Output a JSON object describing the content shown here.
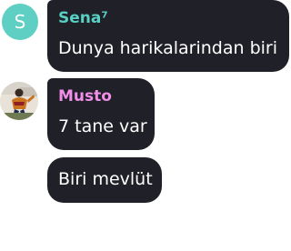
{
  "colors": {
    "bubble_bg": "#202028",
    "message_text": "#ffffff",
    "avatar_s_bg": "#5ecfc2",
    "sena_name": "#58d0c4",
    "musto_name": "#f08ee8"
  },
  "messages": [
    {
      "sender": "Sena⁷",
      "avatar_letter": "S",
      "text": "Dunya harikalarindan biri"
    },
    {
      "sender": "Musto",
      "avatar_icon": "profile-photo",
      "text": "7 tane var"
    },
    {
      "text": "Biri mevlüt"
    }
  ]
}
